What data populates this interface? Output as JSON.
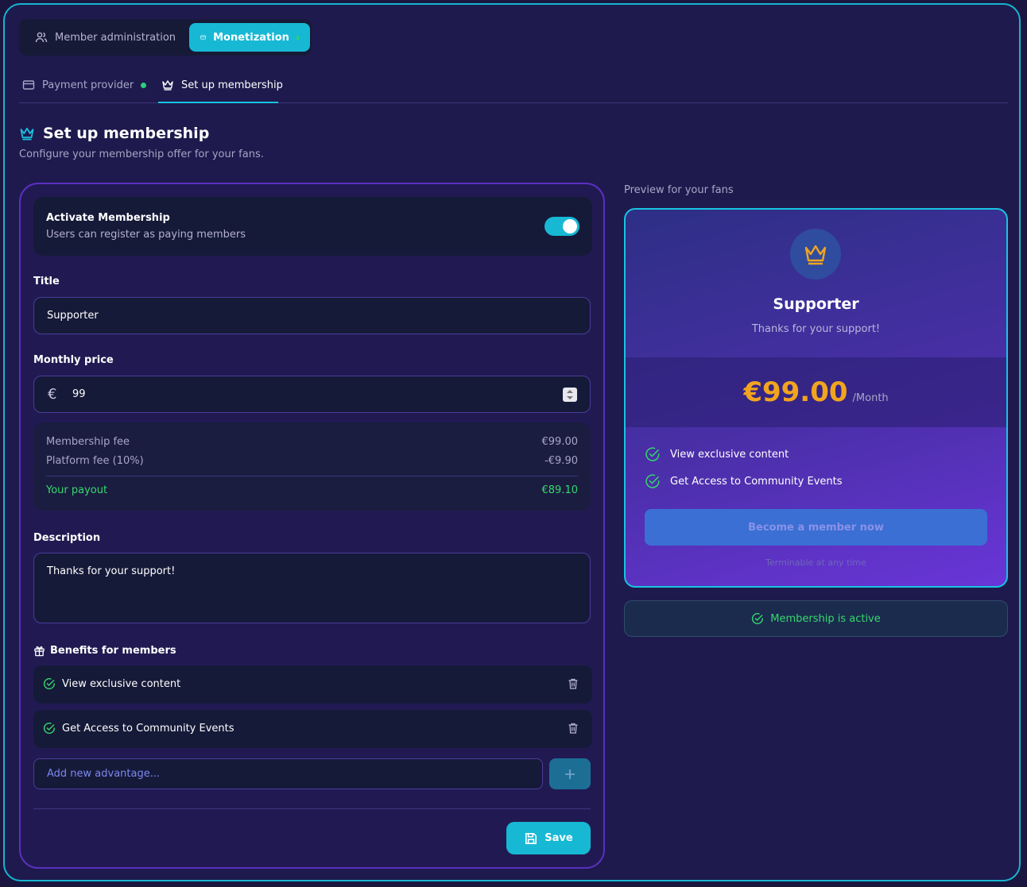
{
  "top_tabs": {
    "member_admin": "Member administration",
    "monetization": "Monetization"
  },
  "sub_tabs": {
    "payment_provider": "Payment provider",
    "setup_membership": "Set up membership"
  },
  "page": {
    "title": "Set up membership",
    "subtitle": "Configure your membership offer for your fans."
  },
  "activate": {
    "title": "Activate Membership",
    "subtitle": "Users can register as paying members",
    "enabled": true
  },
  "form": {
    "title_label": "Title",
    "title_value": "Supporter",
    "price_label": "Monthly price",
    "currency_symbol": "€",
    "price_value": "99",
    "description_label": "Description",
    "description_value": "Thanks for your support!",
    "benefits_label": "Benefits for members",
    "add_placeholder": "Add new advantage...",
    "save_label": "Save"
  },
  "fees": {
    "membership_fee_label": "Membership fee",
    "membership_fee_value": "€99.00",
    "platform_fee_label": "Platform fee (10%)",
    "platform_fee_value": "-€9.90",
    "payout_label": "Your payout",
    "payout_value": "€89.10"
  },
  "benefits": [
    "View exclusive content",
    "Get Access to Community Events"
  ],
  "preview": {
    "label": "Preview for your fans",
    "title": "Supporter",
    "description": "Thanks for your support!",
    "price": "€99.00",
    "per": "/Month",
    "benefits": [
      "View exclusive content",
      "Get Access to Community Events"
    ],
    "cta": "Become a member now",
    "note": "Terminable at any time"
  },
  "status": {
    "active_text": "Membership is active"
  },
  "colors": {
    "accent": "#17b8d4",
    "success": "#36d86e",
    "price": "#f2a41f",
    "border_purple": "#5a2fc0"
  }
}
